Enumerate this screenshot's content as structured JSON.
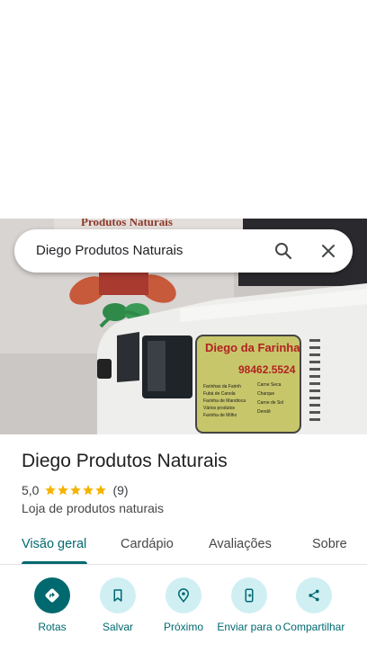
{
  "search": {
    "query": "Diego Produtos Naturais"
  },
  "place": {
    "name": "Diego Produtos Naturais",
    "rating": "5,0",
    "stars": 5,
    "review_count": "(9)",
    "category": "Loja de produtos naturais"
  },
  "photo": {
    "sign_top": "Produtos Naturais",
    "van_sign_title": "Diego da Farinha",
    "van_sign_phone": "98462.5524",
    "van_sign_left": [
      "Farinhas da Farinh",
      "Fubá de Canola",
      "Farinha de Mandioca",
      "Vários produtos",
      "Farinha de Milho"
    ],
    "van_sign_right": [
      "Carne Seca",
      "Charque",
      "Carne de Sol",
      "Dendê"
    ]
  },
  "tabs": [
    "Visão geral",
    "Cardápio",
    "Avaliações",
    "Sobre"
  ],
  "active_tab": "Visão geral",
  "actions": [
    {
      "label": "Rotas",
      "icon": "directions-icon"
    },
    {
      "label": "Salvar",
      "icon": "bookmark-icon"
    },
    {
      "label": "Próximo",
      "icon": "nearby-icon"
    },
    {
      "label": "Enviar para o",
      "icon": "send-to-phone-icon"
    },
    {
      "label": "Compartilhar",
      "icon": "share-icon"
    }
  ],
  "colors": {
    "accent": "#00696f",
    "action_bg": "#cfeff3",
    "star": "#f5b400"
  }
}
